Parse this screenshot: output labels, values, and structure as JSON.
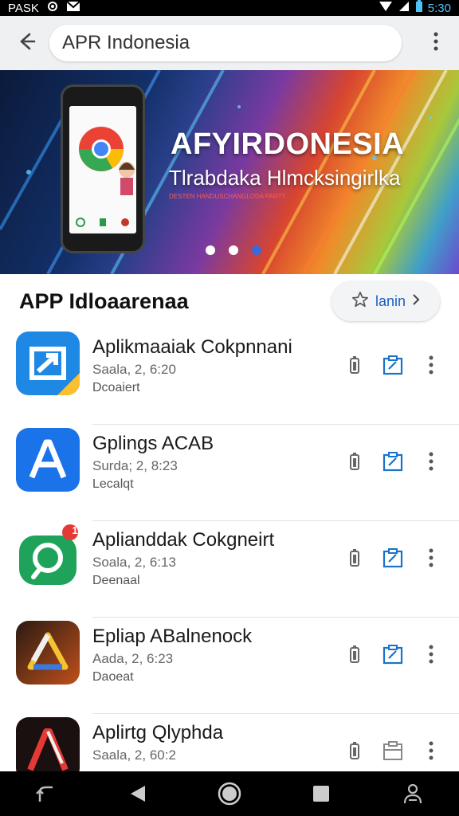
{
  "status_bar": {
    "carrier": "PASK",
    "time": "5:30"
  },
  "search": {
    "value": "APR Indonesia"
  },
  "banner": {
    "title": "AFYIRDONESIA",
    "subtitle": "Tlrabdaka Hlmcksingirlka",
    "small_text": "DESTEN HANDUSCHANGLODA PARTY",
    "dots": 3,
    "active_dot": 2
  },
  "section": {
    "title": "APP Idloaarenaa",
    "chip_label": "lanin"
  },
  "apps": [
    {
      "name": "Aplikmaaiak Cokpnnani",
      "meta": "Saala, 2, 6:20",
      "sub": "Dcoaiert",
      "icon": "blue-arrow-app-icon"
    },
    {
      "name": "Gplings ACAB",
      "meta": "Surda; 2, 8:23",
      "sub": "Lecalqt",
      "icon": "blue-a-app-icon"
    },
    {
      "name": "Aplianddak Cokgneirt",
      "meta": "Soala, 2, 6:13",
      "sub": "Deenaal",
      "icon": "green-search-app-icon",
      "badge": "1"
    },
    {
      "name": "Epliap ABalnenock",
      "meta": "Aada, 2, 6:23",
      "sub": "Daoeat",
      "icon": "drive-triangle-app-icon"
    },
    {
      "name": "Aplirtg Qlyphda",
      "meta": "Saala, 2, 60:2",
      "sub": "",
      "icon": "red-a-app-icon"
    }
  ],
  "colors": {
    "accent": "#1a5fbf",
    "banner_dot_active": "#3a6ad8"
  }
}
